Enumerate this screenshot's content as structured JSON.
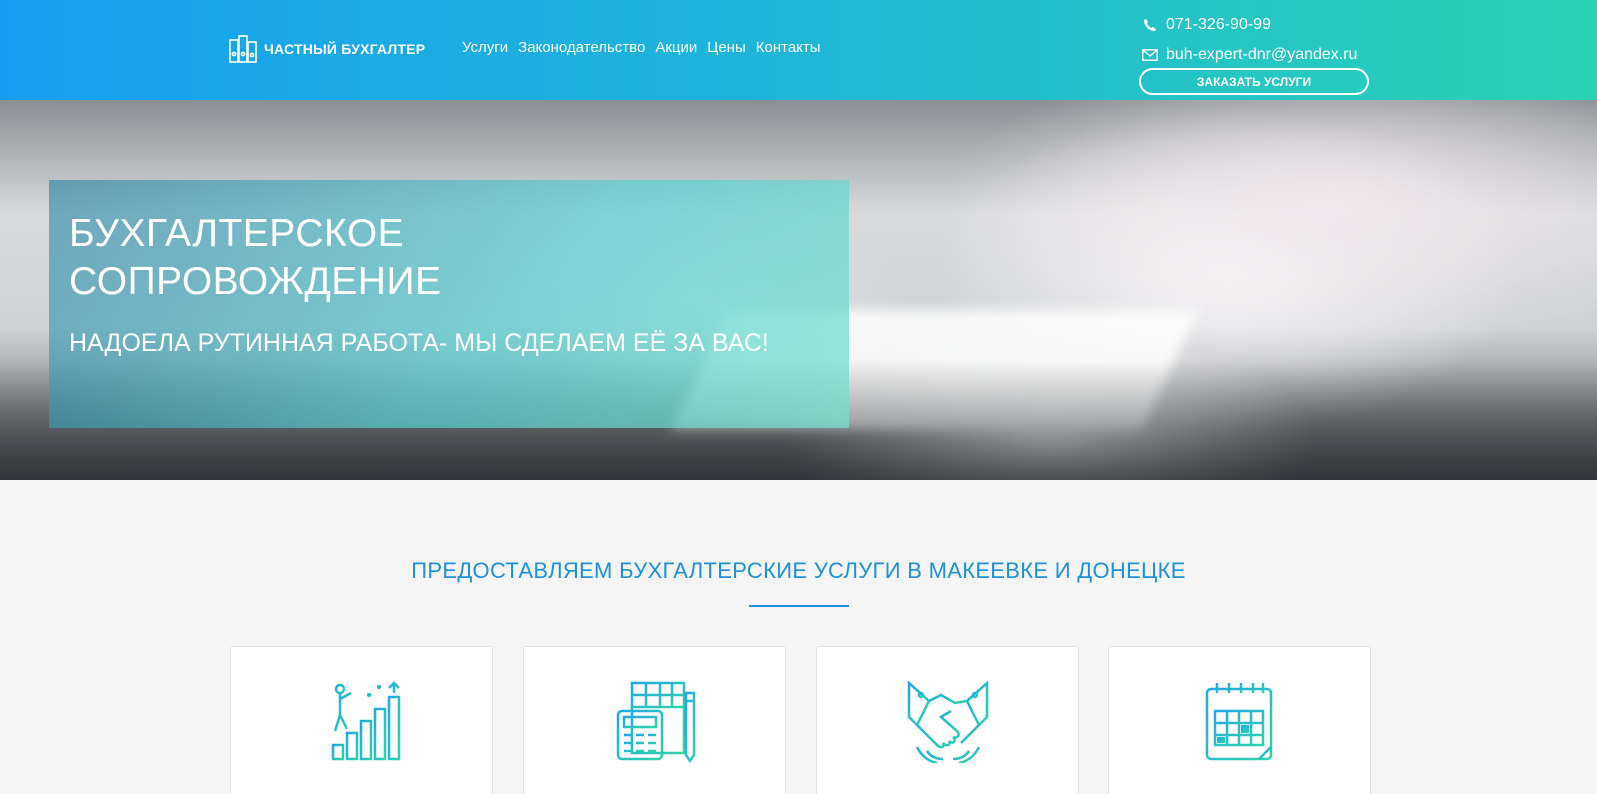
{
  "header": {
    "logo_text": "ЧАСТНЫЙ БУХГАЛТЕР",
    "nav": [
      "Услуги",
      "Законодательство",
      "Акции",
      "Цены",
      "Контакты"
    ],
    "phone": "071-326-90-99",
    "email": "buh-expert-dnr@yandex.ru",
    "order_button": "ЗАКАЗАТЬ УСЛУГИ",
    "gradient": [
      "#169ff0",
      "#2ad2b3"
    ]
  },
  "hero": {
    "title_line1": "БУХГАЛТЕРСКОЕ",
    "title_line2": "СОПРОВОЖДЕНИЕ",
    "subtitle": "НАДОЕЛА РУТИННАЯ РАБОТА- МЫ СДЕЛАЕМ ЕЁ ЗА ВАС!"
  },
  "services": {
    "title": "ПРЕДОСТАВЛЯЕМ БУХГАЛТЕРСКИЕ УСЛУГИ В МАКЕЕВКЕ И ДОНЕЦКЕ",
    "accent": "#1e90dc",
    "cards": [
      {
        "icon": "growth-chart-icon"
      },
      {
        "icon": "calculator-icon"
      },
      {
        "icon": "handshake-icon"
      },
      {
        "icon": "calendar-icon"
      }
    ]
  }
}
